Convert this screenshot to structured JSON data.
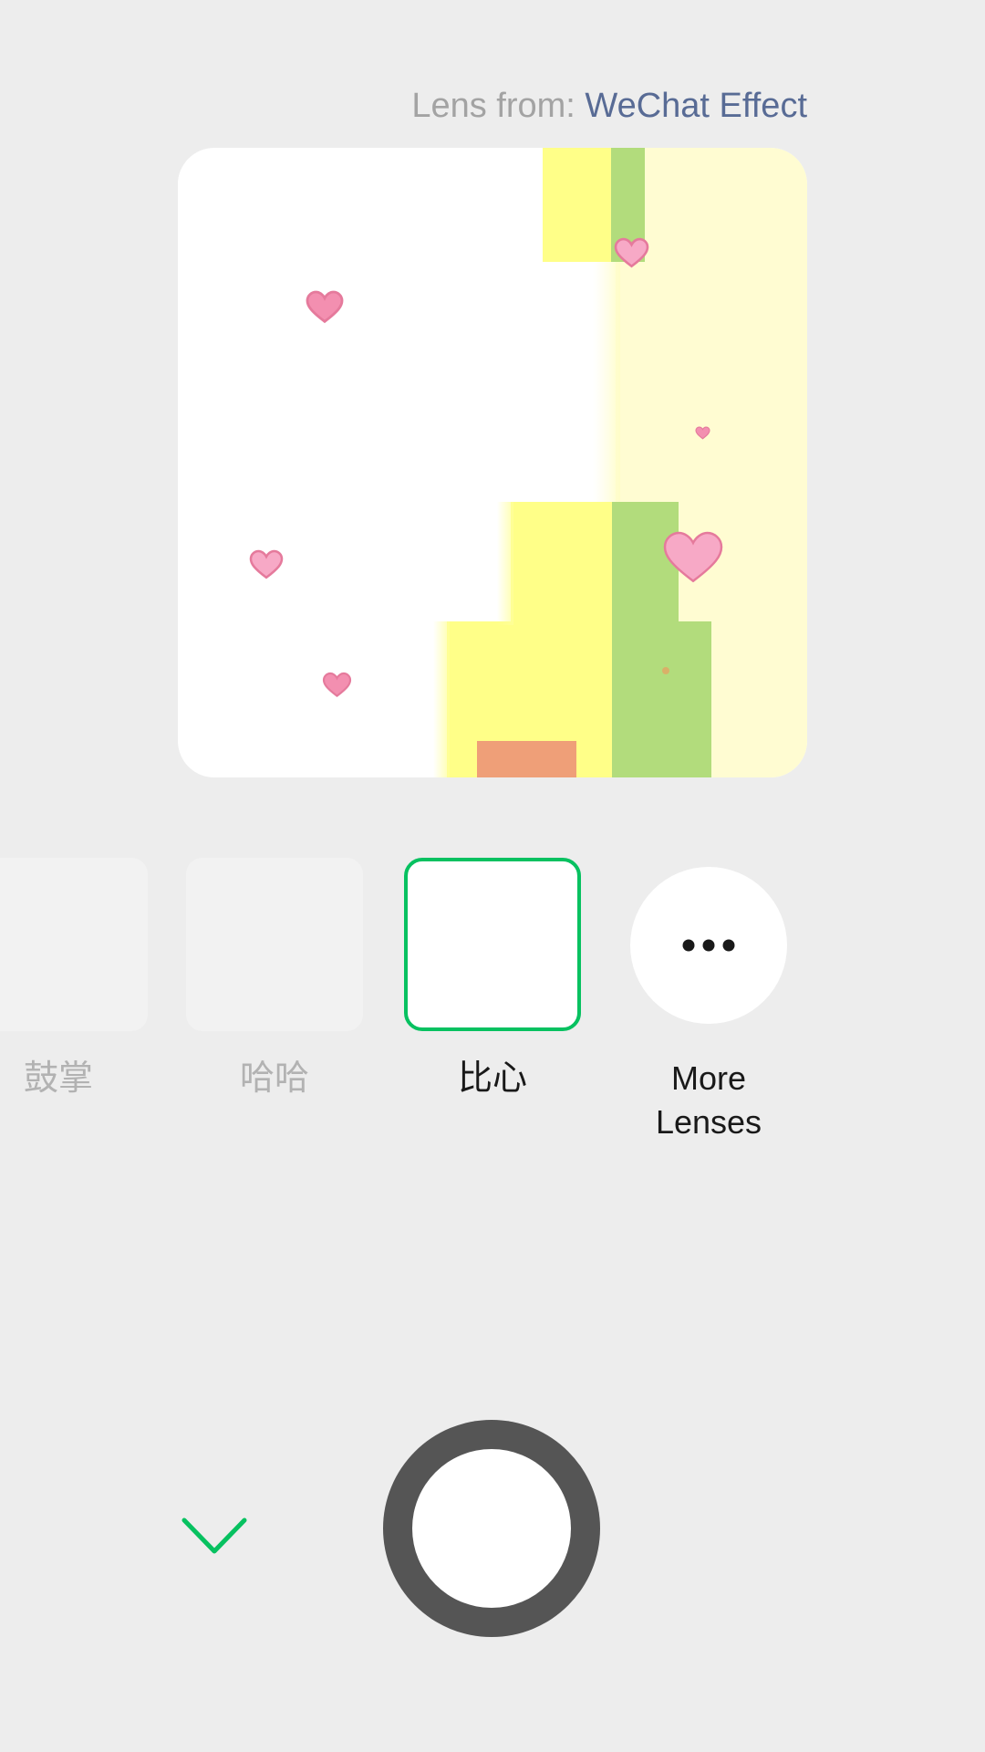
{
  "lens_source": {
    "prefix": "Lens from: ",
    "link": "WeChat Effect"
  },
  "preview": {
    "camera_switch_icon": "camera-switch-icon"
  },
  "lenses": [
    {
      "label": "鼓掌",
      "state": "dim"
    },
    {
      "label": "哈哈",
      "state": "dim"
    },
    {
      "label": "比心",
      "state": "selected"
    }
  ],
  "more_lenses": {
    "label_line1": "More",
    "label_line2": "Lenses",
    "icon": "more-dots-icon"
  },
  "controls": {
    "collapse_icon": "chevron-down-icon",
    "shutter_icon": "shutter-button"
  },
  "colors": {
    "accent": "#07c160",
    "link": "#586b95",
    "background": "#ededed"
  }
}
